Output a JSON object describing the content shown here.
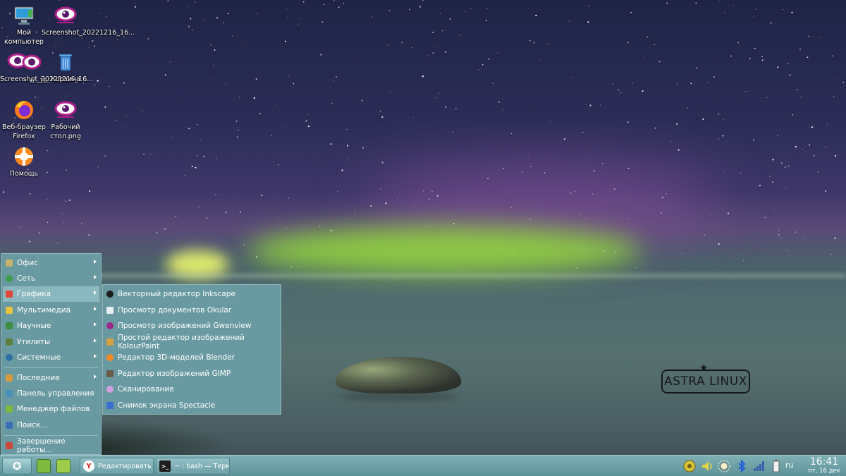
{
  "desktop": {
    "icons": [
      {
        "label": "Мой компьютер",
        "icon": "computer-icon"
      },
      {
        "label": "Screenshot_20221216_16...",
        "icon": "gwenview-eye-icon"
      },
      {
        "label": "Screenshot_20221216_16...",
        "icon": "gwenview-eye-icon"
      },
      {
        "label": "Корзина",
        "icon": "trash-icon"
      },
      {
        "label": "Веб-браузер Firefox",
        "icon": "firefox-icon"
      },
      {
        "label": "Рабочий стол.png",
        "icon": "gwenview-eye-icon"
      },
      {
        "label": "Помощь",
        "icon": "help-lifebuoy-icon"
      }
    ],
    "overlap_label": "ю...16..."
  },
  "wallpaper": {
    "logo_text": "ASTRA LINUX"
  },
  "start_menu": {
    "items": [
      {
        "label": "Офис",
        "has_submenu": true,
        "icon": "office-icon"
      },
      {
        "label": "Сеть",
        "has_submenu": true,
        "icon": "network-icon"
      },
      {
        "label": "Графика",
        "has_submenu": true,
        "icon": "graphics-icon",
        "active": true
      },
      {
        "label": "Мультимедиа",
        "has_submenu": true,
        "icon": "multimedia-icon"
      },
      {
        "label": "Научные",
        "has_submenu": true,
        "icon": "science-icon"
      },
      {
        "label": "Утилиты",
        "has_submenu": true,
        "icon": "utilities-icon"
      },
      {
        "label": "Системные",
        "has_submenu": true,
        "icon": "system-icon"
      },
      {
        "label": "Последние",
        "has_submenu": true,
        "icon": "recent-icon"
      },
      {
        "label": "Панель управления",
        "has_submenu": false,
        "icon": "control-panel-icon"
      },
      {
        "label": "Менеджер файлов",
        "has_submenu": false,
        "icon": "file-manager-icon"
      },
      {
        "label": "Поиск...",
        "has_submenu": false,
        "icon": "search-icon"
      },
      {
        "label": "Завершение работы...",
        "has_submenu": false,
        "icon": "shutdown-icon"
      }
    ]
  },
  "graphics_submenu": {
    "items": [
      {
        "label": "Векторный редактор Inkscape",
        "icon": "inkscape-icon"
      },
      {
        "label": "Просмотр документов Okular",
        "icon": "okular-icon"
      },
      {
        "label": "Просмотр изображений Gwenview",
        "icon": "gwenview-icon"
      },
      {
        "label": "Простой редактор изображений KolourPaint",
        "icon": "kolourpaint-icon"
      },
      {
        "label": "Редактор 3D-моделей Blender",
        "icon": "blender-icon"
      },
      {
        "label": "Редактор изображений GIMP",
        "icon": "gimp-icon"
      },
      {
        "label": "Сканирование",
        "icon": "scanner-icon"
      },
      {
        "label": "Снимок экрана Spectacle",
        "icon": "spectacle-icon"
      }
    ]
  },
  "taskbar": {
    "tasks": [
      {
        "label": "Редактировать ...",
        "icon": "yandex-browser-icon",
        "icon_glyph": "Y"
      },
      {
        "label": "~ : bash — Терм...",
        "icon": "terminal-icon",
        "icon_glyph": ">_"
      }
    ],
    "language": "ru",
    "clock": {
      "time": "16:41",
      "date": "пт, 16 дек"
    }
  },
  "colors": {
    "menu_bg": "#6a9aa1",
    "menu_active": "#8bb8be",
    "taskbar_bg": "#6ea3aa"
  }
}
